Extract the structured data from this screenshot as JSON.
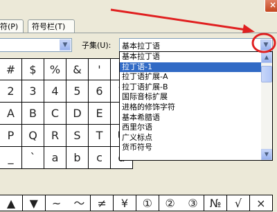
{
  "window": {
    "close_label": "×"
  },
  "tabs": [
    {
      "label": "符(P)"
    },
    {
      "label": "符号栏(T)"
    }
  ],
  "font_combo": {
    "value": ""
  },
  "subset": {
    "label": "子集(U):",
    "value": "基本拉丁语",
    "options": [
      "基本拉丁语",
      "拉丁语-1",
      "拉丁语扩展-A",
      "拉丁语扩展-B",
      "国际音标扩展",
      "进格的修饰字符",
      "基本希腊语",
      "西里尔语",
      "广义标点",
      "货币符号"
    ],
    "selected_index": 1
  },
  "symbol_grid": {
    "rows": [
      [
        "#",
        "$",
        "%",
        "&",
        "'",
        "("
      ],
      [
        "2",
        "3",
        "4",
        "5",
        "6",
        "7"
      ],
      [
        "A",
        "B",
        "C",
        "D",
        "E",
        "F"
      ],
      [
        "P",
        "Q",
        "R",
        "S",
        "T",
        "U"
      ],
      [
        "_",
        "`",
        "a",
        "b",
        "c",
        "d"
      ]
    ]
  },
  "recent": {
    "label": ":",
    "symbols": [
      "▲",
      "▼",
      "~",
      "～",
      "≠",
      "¥",
      "①",
      "②",
      "③",
      "№",
      "√",
      "×"
    ]
  },
  "icons": {
    "dropdown": "chevron-down-icon",
    "close": "close-icon"
  },
  "colors": {
    "highlight": "#316ac5",
    "annotation": "#e02020"
  }
}
